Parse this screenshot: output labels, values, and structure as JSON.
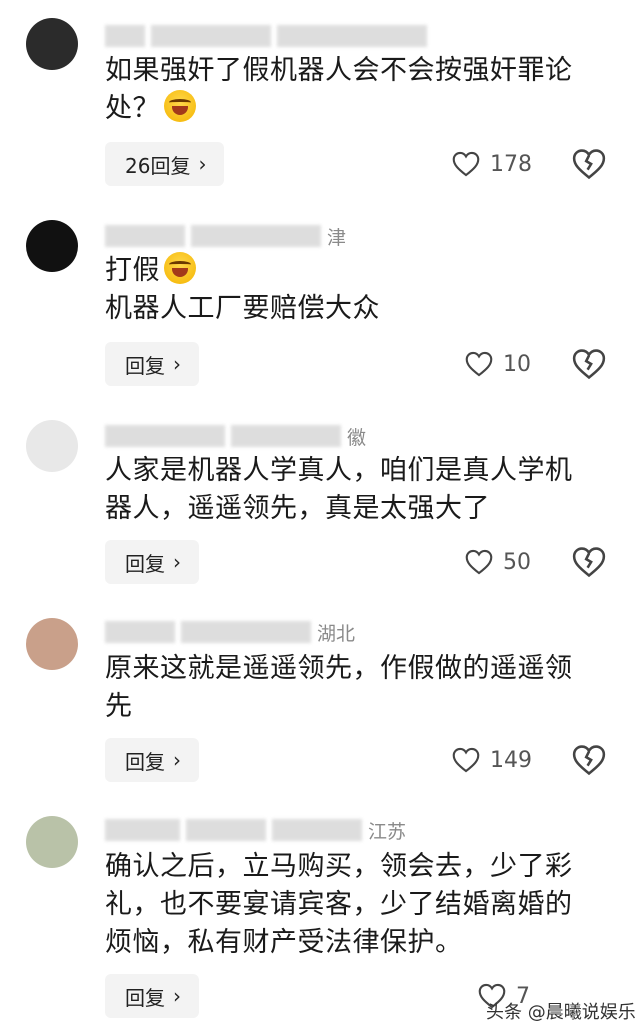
{
  "comments": [
    {
      "text_lines": [
        "如果强奸了假机器人会不会按强奸罪论",
        "处？"
      ],
      "has_emoji": true,
      "reply_label": "26回复",
      "likes": "178",
      "location": ""
    },
    {
      "text_lines": [
        "打假",
        "机器人工厂要赔偿大众"
      ],
      "has_emoji": true,
      "reply_label": "回复",
      "likes": "10",
      "location": "津"
    },
    {
      "text_lines": [
        "人家是机器人学真人，咱们是真人学机",
        "器人，遥遥领先，真是太强大了"
      ],
      "has_emoji": false,
      "reply_label": "回复",
      "likes": "50",
      "location": "徽"
    },
    {
      "text_lines": [
        "原来这就是遥遥领先，作假做的遥遥领",
        "先"
      ],
      "has_emoji": false,
      "reply_label": "回复",
      "likes": "149",
      "location": "湖北"
    },
    {
      "text_lines": [
        "确认之后，立马购买，领会去，少了彩",
        "礼，也不要宴请宾客，少了结婚离婚的",
        "烦恼，私有财产受法律保护。"
      ],
      "has_emoji": false,
      "reply_label": "回复",
      "likes": "7",
      "location": "江苏"
    }
  ],
  "watermark": "头条 @晨曦说娱乐"
}
